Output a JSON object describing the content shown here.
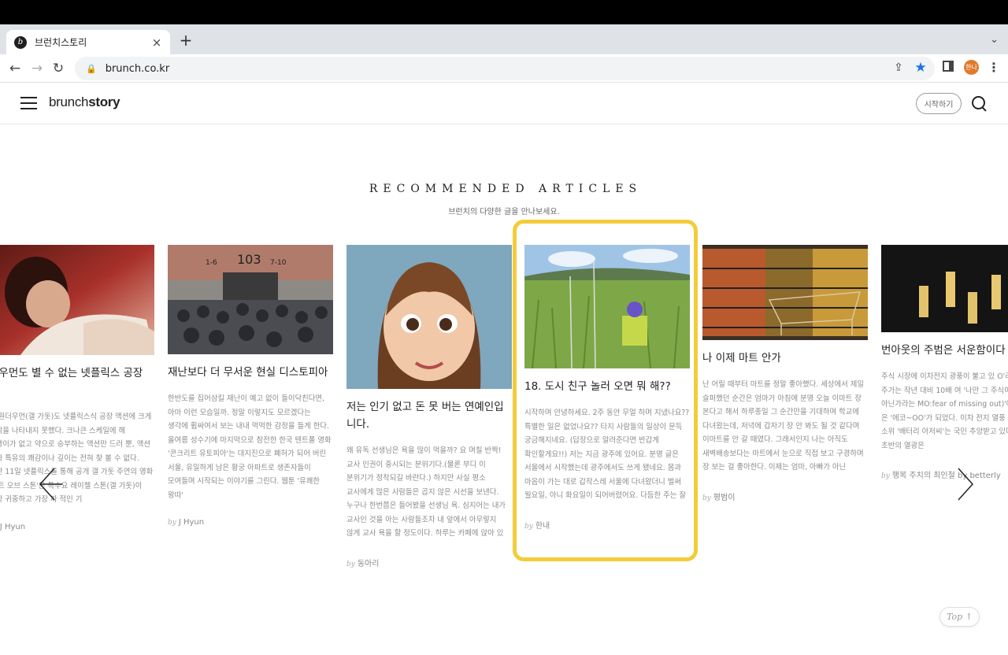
{
  "browser": {
    "tab_title": "브런치스토리",
    "url": "brunch.co.kr",
    "profile_label": "한나",
    "new_tab_label": "+",
    "tab_close": "×"
  },
  "site": {
    "logo_a": "brunch",
    "logo_b": "story",
    "start_button": "시작하기"
  },
  "section": {
    "title": "RECOMMENDED ARTICLES",
    "subtitle": "브런치의 다양한 글을 만나보세요."
  },
  "articles": [
    {
      "title": "더우먼도 별 수 없는 넷플릭스 공장 션",
      "excerpt": "국 원더우먼(갤 가돗)도 넷플릭스식 공장 액션에 크게 두각을 나타내지 못했다. 크나큰 스케일에 해 알맹이가 없고 약으로 승부하는 액션만 드러 뿐, 액션 영화 특유의 쾌감이나 깊이는 전혀 찾 볼 수 없다. 지난 11일 넷플릭스를 통해 공개 갤 가돗 주연의 영화 '하트 오브 스톤'은 특수요 레이첼 스톤(갤 가돗)이 가장 귀중하고 가장 파 적인 기",
      "by": "J Hyun"
    },
    {
      "title": "재난보다 더 무서운 현실 디스토피아",
      "excerpt": "한반도를 집어삼킬 재난이 예고 없이 들이닥친다면, 아마 이런 모습일까. 정말 이렇지도 모르겠다는 생각에 휩싸여서 보는 내내 먹먹한 감정을 들게 한다. 올여름 성수기에 마지막으로 참전한 한국 텐트폴 영화 '콘크리트 유토피아'는 대지진으로 폐허가 되어 버린 서울, 유일하게 남은 황궁 아파트로 생존자들이 모여들며 시작되는 이야기를 그린다. 웹툰 '유쾌한 왕따'",
      "by": "J Hyun"
    },
    {
      "title": "저는 인기 없고 돈 못 버는 연예인입니다.",
      "excerpt": "왜 유독 선생님은 욕을 많이 먹을까? 요 며칠 반짝! 교사 인권이 중시되는 분위기다.(물론 부디 이 분위기가 정착되길 바란다.) 하지만 사실 평소 교사에게 많은 사람들은 곱지 않은 시선을 보낸다. 누구나 한번쯤은 들어봤을 선생님 욕. 심지어는 내가 교사인 것을 아는 사람들조차 내 앞에서 아무렇지 않게 교사 욕을 할 정도이다. 하루는 카페에 앉아 있",
      "by": "동아리"
    },
    {
      "title": "18. 도시 친구 놀러 오면 뭐 해??",
      "excerpt": "시작하며 안녕하세요. 2주 동안 무얼 하며 지냈나요?? 특별한 일은 없었나요?? 타지 사람들의 일상이 문득 궁금해지네요. (답장으로 알려준다면 반갑게 확인할게요!!) 저는 지금 광주에 있어요. 분명 글은 서울에서 시작했는데 광주에서도 쓰게 됐네요. 몸과 마음이 가는 대로 갑작스레 서울에 다녀왔더니 벌써 월요일, 아니 화요일이 되어버렸어요. 다듬한 주는 잘",
      "by": "한내"
    },
    {
      "title": "나 이제 마트 안가",
      "excerpt": "난 어릴 때부터 마트를 정말 좋아했다. 세상에서 제일 슬퍼했던 순간은 엄마가 아침에 분명 오늘 이마트 장 본다고 해서 하루종일 그 순간만을 기대하며 학교에 다녀왔는데, 저녁에 갑자기 장 안 봐도 될 것 같다며 이마트를 안 갈 때였다. 그래서인지 나는 아직도 새벽배송보다는 마트에서 눈으로 직접 보고 구경하며 장 보는 걸 좋아한다. 이제는 엄마, 아빠가 아닌",
      "by": "평범이"
    },
    {
      "title": "번아웃의 주범은 서운함이다",
      "excerpt": "주식 시장에 이차전지 광풍이 불고 있 O'라는 회사의 주가는 작년 대비 10배 여 '나만 그 주식이 없는 것 아닌가라는 MO:fear of missing out)'에 장탄식을 은 '에코~OO'가 되었다. 이차 전지 열풍 치 예측한 소위 '배터리 아저씨'는 국민 추앙받고 있다. 그러나 초반의 열광은",
      "by": "행복 주치의 최인철 by betterly"
    }
  ],
  "top_button": "Top ↑"
}
